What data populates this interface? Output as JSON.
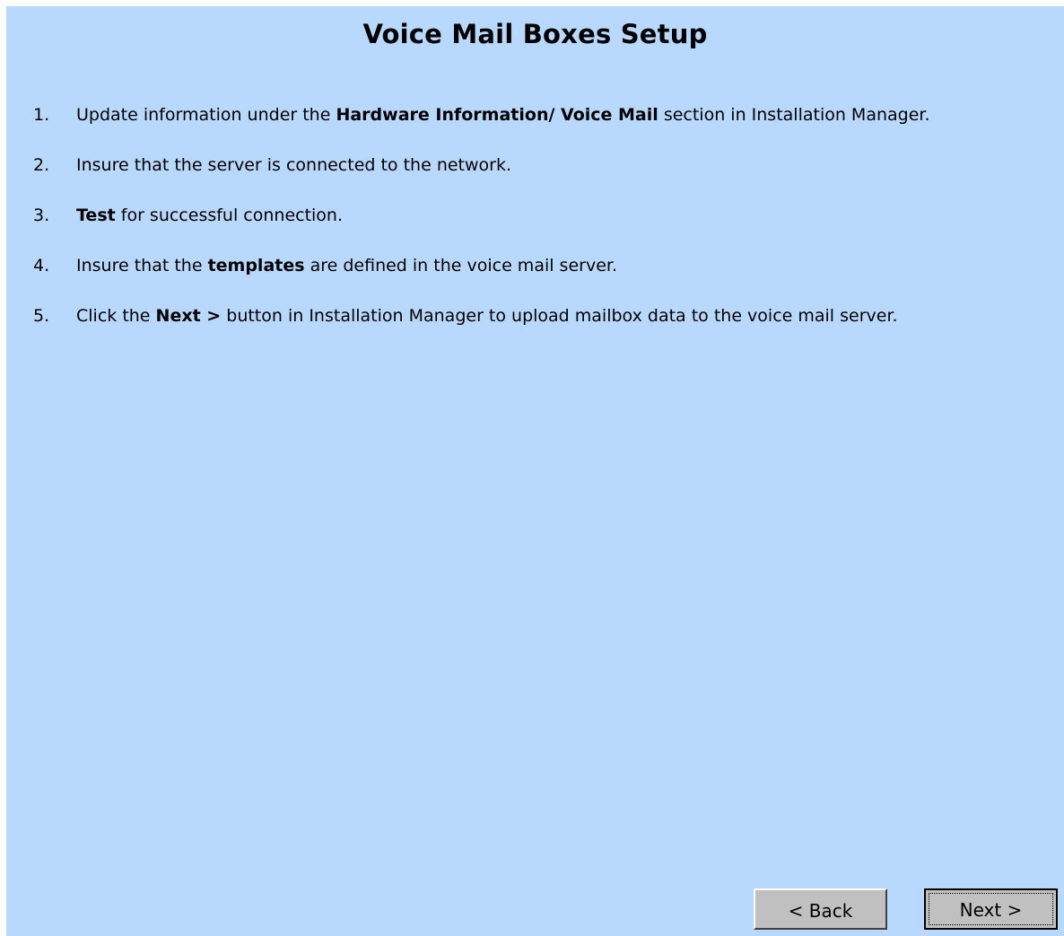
{
  "page": {
    "title": "Voice Mail Boxes Setup"
  },
  "steps": [
    {
      "number": "1.",
      "segments": [
        {
          "text": "Update information under the ",
          "bold": false
        },
        {
          "text": "Hardware Information/ Voice Mail",
          "bold": true
        },
        {
          "text": " section in Installation Manager.",
          "bold": false
        }
      ]
    },
    {
      "number": "2.",
      "segments": [
        {
          "text": "Insure that the server is connected to the network.",
          "bold": false
        }
      ]
    },
    {
      "number": "3.",
      "segments": [
        {
          "text": "Test",
          "bold": true
        },
        {
          "text": " for successful connection.",
          "bold": false
        }
      ]
    },
    {
      "number": "4.",
      "segments": [
        {
          "text": "Insure that the ",
          "bold": false
        },
        {
          "text": "templates",
          "bold": true
        },
        {
          "text": " are defined in the voice mail server.",
          "bold": false
        }
      ]
    },
    {
      "number": "5.",
      "segments": [
        {
          "text": "Click the ",
          "bold": false
        },
        {
          "text": "Next >",
          "bold": true
        },
        {
          "text": " button in Installation Manager to upload mailbox data to the voice mail server.",
          "bold": false
        }
      ]
    }
  ],
  "buttons": {
    "back_label": "< Back",
    "next_label": "Next >"
  },
  "colors": {
    "panel_background": "#b8d8fe",
    "button_face": "#c0c0c0"
  }
}
